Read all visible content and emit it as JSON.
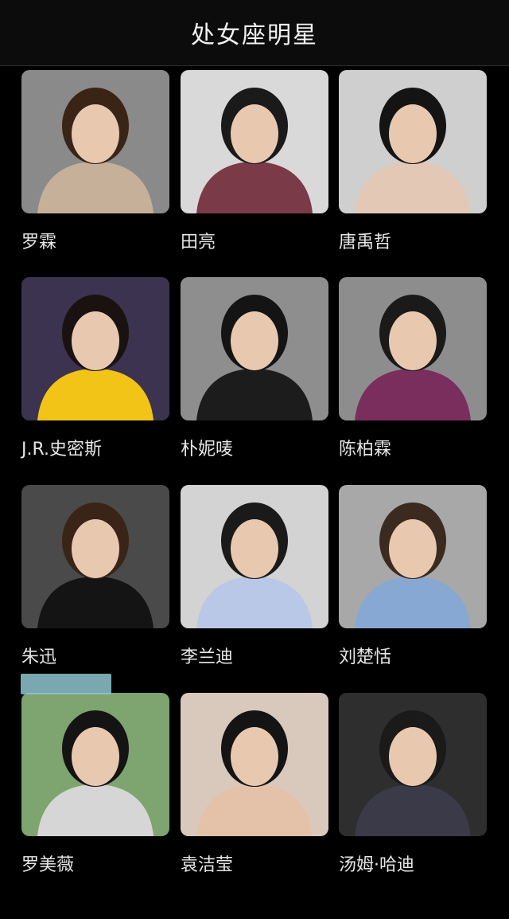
{
  "header": {
    "title": "处女座明星"
  },
  "celebrities": [
    {
      "name": "罗霖",
      "bg": "#8a8a8a",
      "fg": "#c7b09a",
      "hair": "#3a2416"
    },
    {
      "name": "田亮",
      "bg": "#d9d9d9",
      "fg": "#7a3a48",
      "hair": "#1a1a1a"
    },
    {
      "name": "唐禹哲",
      "bg": "#cfcfcf",
      "fg": "#e2c8b5",
      "hair": "#141414"
    },
    {
      "name": "J.R.史密斯",
      "bg": "#3b3350",
      "fg": "#f2c417",
      "hair": "#1a1210"
    },
    {
      "name": "朴妮唛",
      "bg": "#8e8e8e",
      "fg": "#1c1c1c",
      "hair": "#141414"
    },
    {
      "name": "陈柏霖",
      "bg": "#8d8d8d",
      "fg": "#7a2e5e",
      "hair": "#1a1a1a"
    },
    {
      "name": "朱迅",
      "bg": "#4a4a4a",
      "fg": "#141414",
      "hair": "#3a2418"
    },
    {
      "name": "李兰迪",
      "bg": "#d3d3d3",
      "fg": "#b9c8e6",
      "hair": "#1a1a1a"
    },
    {
      "name": "刘楚恬",
      "bg": "#a8a8a8",
      "fg": "#86a8d2",
      "hair": "#3a2a20"
    },
    {
      "name": "罗美薇",
      "bg": "#7ea470",
      "fg": "#d6d6d6",
      "hair": "#141414"
    },
    {
      "name": "袁洁莹",
      "bg": "#d9c8bc",
      "fg": "#e4c2aa",
      "hair": "#141414"
    },
    {
      "name": "汤姆·哈迪",
      "bg": "#2e2e2e",
      "fg": "#3a3a48",
      "hair": "#1a1a1a"
    }
  ]
}
